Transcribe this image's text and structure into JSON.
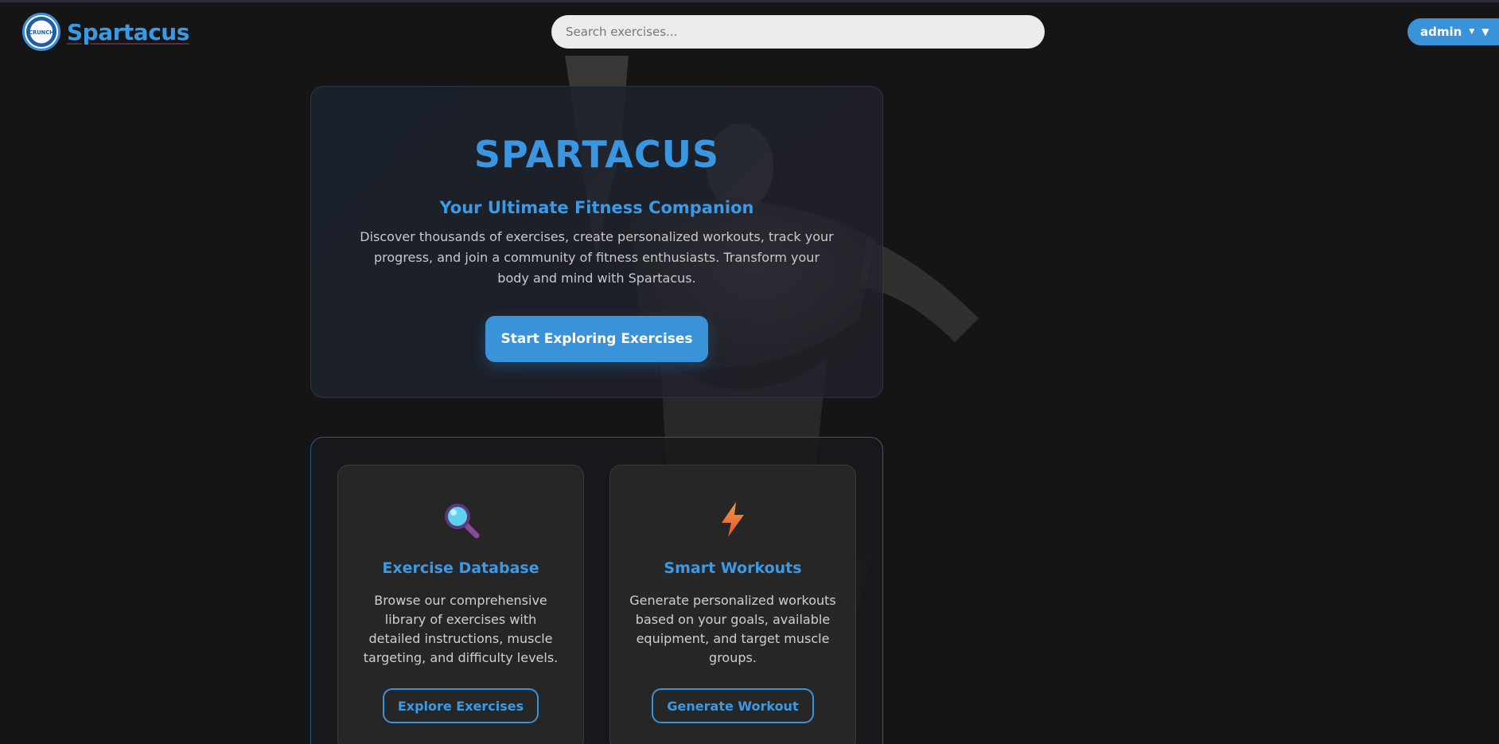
{
  "header": {
    "brand_name": "Spartacus",
    "logo_text": "CRUNCH",
    "search_placeholder": "Search exercises...",
    "user_label": "admin"
  },
  "hero": {
    "title": "SPARTACUS",
    "subtitle": "Your Ultimate Fitness Companion",
    "description": "Discover thousands of exercises, create personalized workouts, track your progress, and join a community of fitness enthusiasts. Transform your body and mind with Spartacus.",
    "cta_label": "Start Exploring Exercises"
  },
  "features": [
    {
      "icon": "magnifying-glass-icon",
      "title": "Exercise Database",
      "description": "Browse our comprehensive library of exercises with detailed instructions, muscle targeting, and difficulty levels.",
      "button_label": "Explore Exercises"
    },
    {
      "icon": "lightning-icon",
      "title": "Smart Workouts",
      "description": "Generate personalized workouts based on your goals, available equipment, and target muscle groups.",
      "button_label": "Generate Workout"
    }
  ],
  "colors": {
    "accent": "#3a93d9",
    "background": "#151515",
    "card": "#282828"
  }
}
